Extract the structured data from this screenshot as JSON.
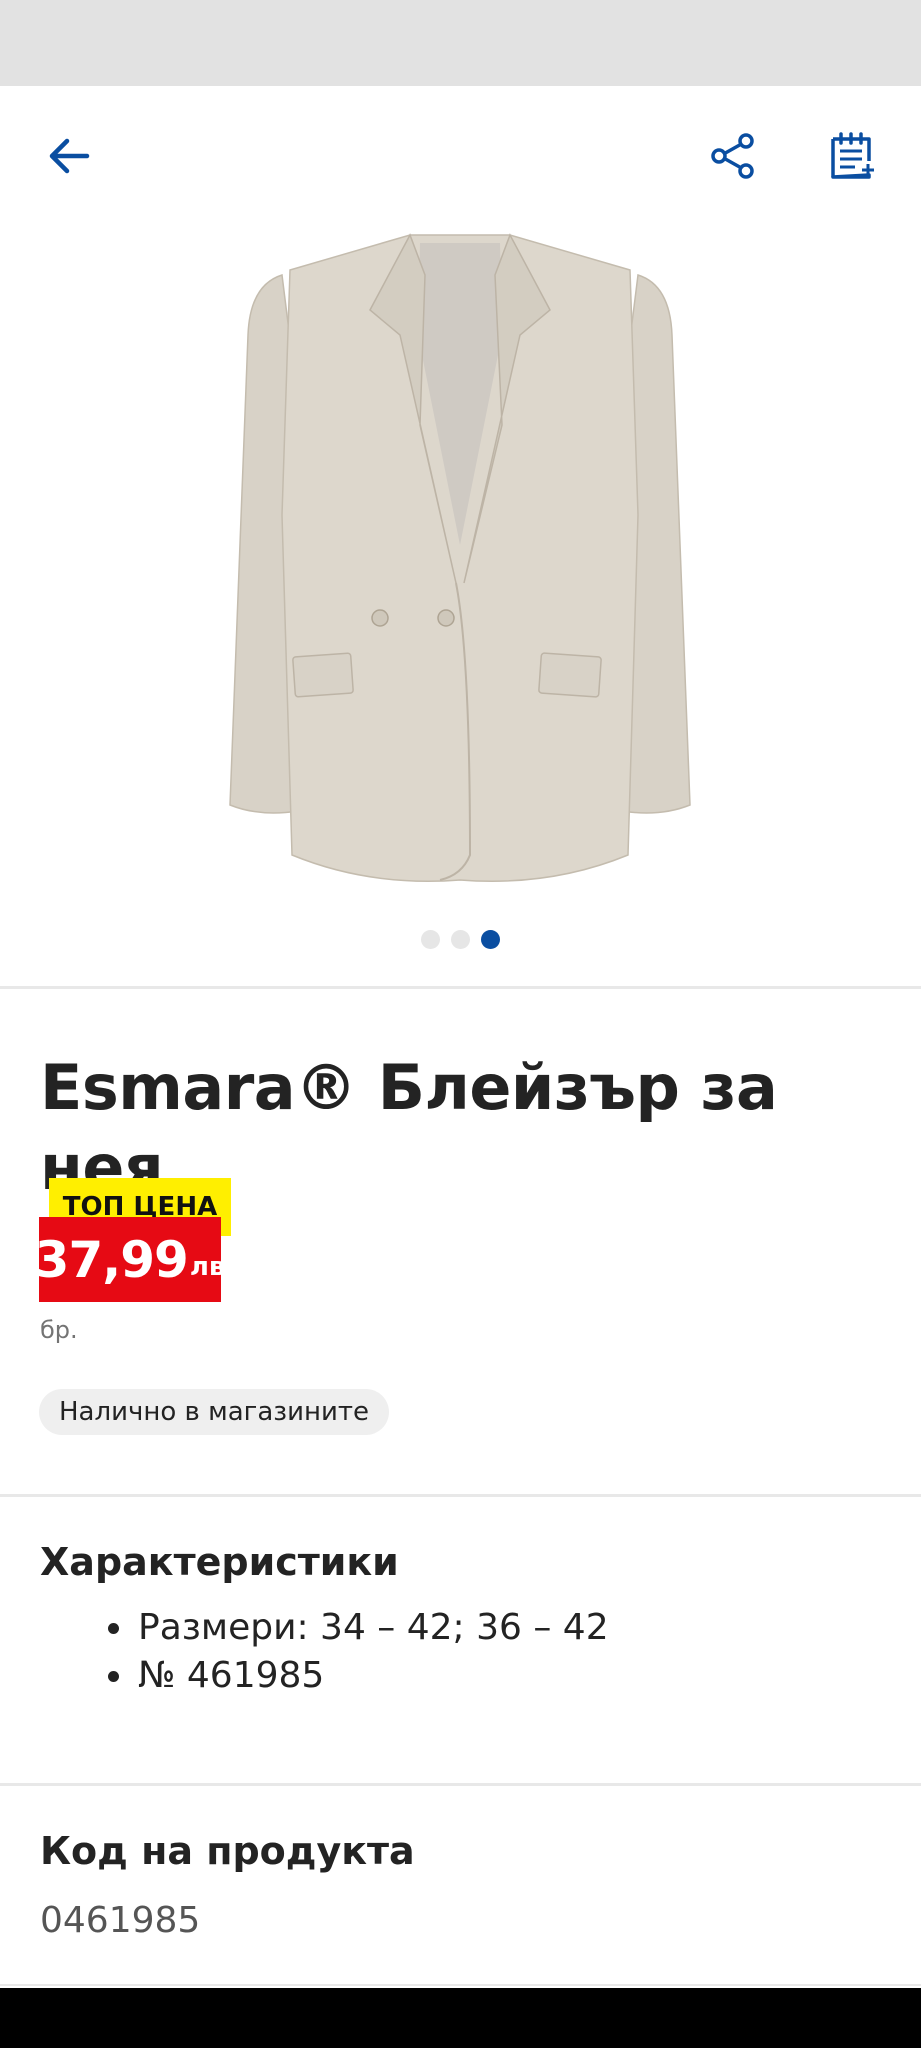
{
  "colors": {
    "accent": "#0a4ea1",
    "price_bg": "#e60a14",
    "badge_bg": "#ffef00",
    "chip_bg": "#efefef",
    "status_bar": "#e2e2e2"
  },
  "app_bar": {
    "back_icon": "arrow-left-icon",
    "share_icon": "share-icon",
    "shopping_list_icon": "shopping-list-add-icon"
  },
  "gallery": {
    "image_count": 3,
    "active_index": 2
  },
  "product": {
    "title": "Esmara® Блейзър за нея",
    "badge": "ТОП ЦЕНА",
    "price": "37,99",
    "currency": "лв",
    "unit": "бр.",
    "availability": "Налично в магазините"
  },
  "characteristics": {
    "heading": "Характеристики",
    "items": [
      "Размери: 34 – 42; 36 – 42",
      "№ 461985"
    ]
  },
  "product_code": {
    "heading": "Код на продукта",
    "value": "0461985"
  }
}
